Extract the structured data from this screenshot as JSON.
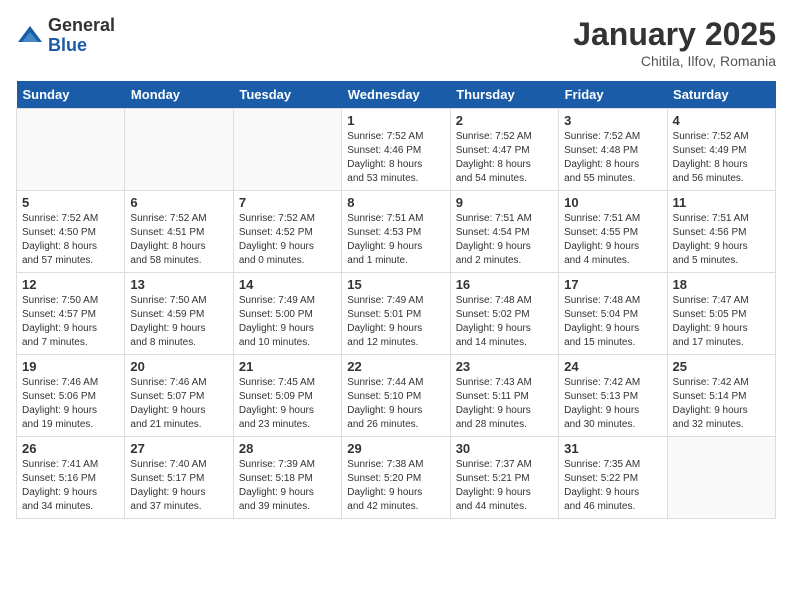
{
  "logo": {
    "general": "General",
    "blue": "Blue"
  },
  "title": "January 2025",
  "location": "Chitila, Ilfov, Romania",
  "days_of_week": [
    "Sunday",
    "Monday",
    "Tuesday",
    "Wednesday",
    "Thursday",
    "Friday",
    "Saturday"
  ],
  "weeks": [
    [
      {
        "day": "",
        "content": ""
      },
      {
        "day": "",
        "content": ""
      },
      {
        "day": "",
        "content": ""
      },
      {
        "day": "1",
        "content": "Sunrise: 7:52 AM\nSunset: 4:46 PM\nDaylight: 8 hours\nand 53 minutes."
      },
      {
        "day": "2",
        "content": "Sunrise: 7:52 AM\nSunset: 4:47 PM\nDaylight: 8 hours\nand 54 minutes."
      },
      {
        "day": "3",
        "content": "Sunrise: 7:52 AM\nSunset: 4:48 PM\nDaylight: 8 hours\nand 55 minutes."
      },
      {
        "day": "4",
        "content": "Sunrise: 7:52 AM\nSunset: 4:49 PM\nDaylight: 8 hours\nand 56 minutes."
      }
    ],
    [
      {
        "day": "5",
        "content": "Sunrise: 7:52 AM\nSunset: 4:50 PM\nDaylight: 8 hours\nand 57 minutes."
      },
      {
        "day": "6",
        "content": "Sunrise: 7:52 AM\nSunset: 4:51 PM\nDaylight: 8 hours\nand 58 minutes."
      },
      {
        "day": "7",
        "content": "Sunrise: 7:52 AM\nSunset: 4:52 PM\nDaylight: 9 hours\nand 0 minutes."
      },
      {
        "day": "8",
        "content": "Sunrise: 7:51 AM\nSunset: 4:53 PM\nDaylight: 9 hours\nand 1 minute."
      },
      {
        "day": "9",
        "content": "Sunrise: 7:51 AM\nSunset: 4:54 PM\nDaylight: 9 hours\nand 2 minutes."
      },
      {
        "day": "10",
        "content": "Sunrise: 7:51 AM\nSunset: 4:55 PM\nDaylight: 9 hours\nand 4 minutes."
      },
      {
        "day": "11",
        "content": "Sunrise: 7:51 AM\nSunset: 4:56 PM\nDaylight: 9 hours\nand 5 minutes."
      }
    ],
    [
      {
        "day": "12",
        "content": "Sunrise: 7:50 AM\nSunset: 4:57 PM\nDaylight: 9 hours\nand 7 minutes."
      },
      {
        "day": "13",
        "content": "Sunrise: 7:50 AM\nSunset: 4:59 PM\nDaylight: 9 hours\nand 8 minutes."
      },
      {
        "day": "14",
        "content": "Sunrise: 7:49 AM\nSunset: 5:00 PM\nDaylight: 9 hours\nand 10 minutes."
      },
      {
        "day": "15",
        "content": "Sunrise: 7:49 AM\nSunset: 5:01 PM\nDaylight: 9 hours\nand 12 minutes."
      },
      {
        "day": "16",
        "content": "Sunrise: 7:48 AM\nSunset: 5:02 PM\nDaylight: 9 hours\nand 14 minutes."
      },
      {
        "day": "17",
        "content": "Sunrise: 7:48 AM\nSunset: 5:04 PM\nDaylight: 9 hours\nand 15 minutes."
      },
      {
        "day": "18",
        "content": "Sunrise: 7:47 AM\nSunset: 5:05 PM\nDaylight: 9 hours\nand 17 minutes."
      }
    ],
    [
      {
        "day": "19",
        "content": "Sunrise: 7:46 AM\nSunset: 5:06 PM\nDaylight: 9 hours\nand 19 minutes."
      },
      {
        "day": "20",
        "content": "Sunrise: 7:46 AM\nSunset: 5:07 PM\nDaylight: 9 hours\nand 21 minutes."
      },
      {
        "day": "21",
        "content": "Sunrise: 7:45 AM\nSunset: 5:09 PM\nDaylight: 9 hours\nand 23 minutes."
      },
      {
        "day": "22",
        "content": "Sunrise: 7:44 AM\nSunset: 5:10 PM\nDaylight: 9 hours\nand 26 minutes."
      },
      {
        "day": "23",
        "content": "Sunrise: 7:43 AM\nSunset: 5:11 PM\nDaylight: 9 hours\nand 28 minutes."
      },
      {
        "day": "24",
        "content": "Sunrise: 7:42 AM\nSunset: 5:13 PM\nDaylight: 9 hours\nand 30 minutes."
      },
      {
        "day": "25",
        "content": "Sunrise: 7:42 AM\nSunset: 5:14 PM\nDaylight: 9 hours\nand 32 minutes."
      }
    ],
    [
      {
        "day": "26",
        "content": "Sunrise: 7:41 AM\nSunset: 5:16 PM\nDaylight: 9 hours\nand 34 minutes."
      },
      {
        "day": "27",
        "content": "Sunrise: 7:40 AM\nSunset: 5:17 PM\nDaylight: 9 hours\nand 37 minutes."
      },
      {
        "day": "28",
        "content": "Sunrise: 7:39 AM\nSunset: 5:18 PM\nDaylight: 9 hours\nand 39 minutes."
      },
      {
        "day": "29",
        "content": "Sunrise: 7:38 AM\nSunset: 5:20 PM\nDaylight: 9 hours\nand 42 minutes."
      },
      {
        "day": "30",
        "content": "Sunrise: 7:37 AM\nSunset: 5:21 PM\nDaylight: 9 hours\nand 44 minutes."
      },
      {
        "day": "31",
        "content": "Sunrise: 7:35 AM\nSunset: 5:22 PM\nDaylight: 9 hours\nand 46 minutes."
      },
      {
        "day": "",
        "content": ""
      }
    ]
  ]
}
